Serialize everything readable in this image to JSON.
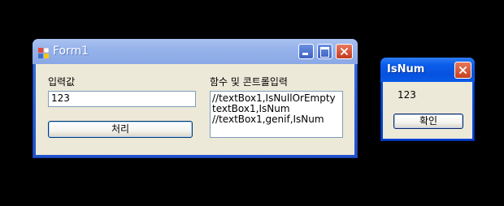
{
  "main_window": {
    "title": "Form1",
    "input_label": "입력값",
    "input_value": "123",
    "process_button": "처리",
    "functions_label": "함수 및 콘트롤입력",
    "functions_lines": [
      "//textBox1,IsNullOrEmpty",
      "textBox1,IsNum",
      "//textBox1,genif,IsNum"
    ]
  },
  "message_box": {
    "title": "IsNum",
    "message": "123",
    "ok_button": "확인"
  },
  "icons": {
    "app": "form-app-icon",
    "minimize": "minimize-icon",
    "maximize": "maximize-icon",
    "close": "close-icon"
  },
  "colors": {
    "desktop_background": "#000000",
    "client_background": "#ece9d8",
    "close_button": "#c8401f",
    "active_titlebar": "#0652e0",
    "inactive_titlebar": "#97b3eb"
  }
}
